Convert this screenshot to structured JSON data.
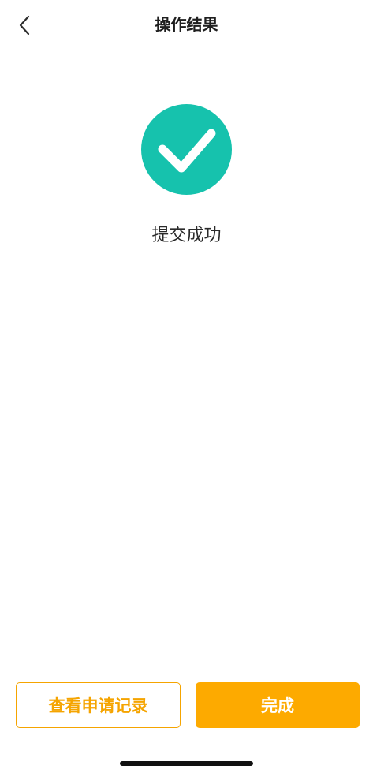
{
  "header": {
    "title": "操作结果",
    "back_icon": "chevron-left-icon"
  },
  "result": {
    "icon": "check-circle-icon",
    "icon_color": "#16c2ad",
    "message": "提交成功"
  },
  "actions": {
    "view_records_label": "查看申请记录",
    "done_label": "完成",
    "accent_color": "#fdaa00"
  }
}
